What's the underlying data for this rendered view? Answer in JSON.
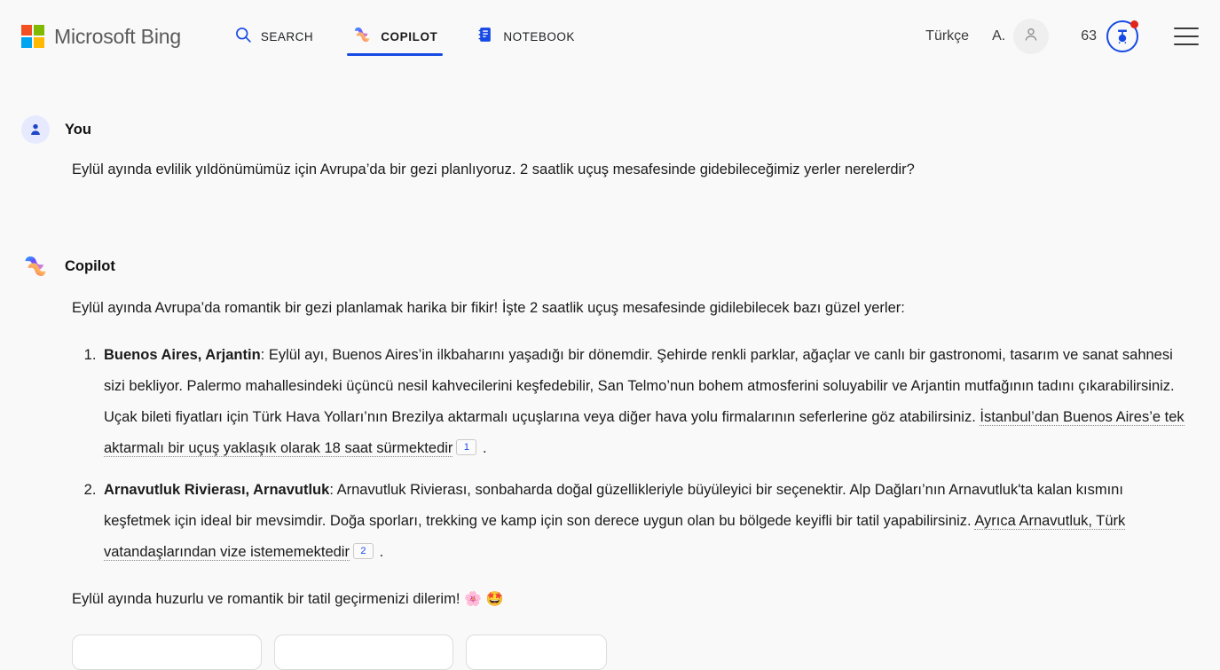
{
  "header": {
    "brand": "Microsoft Bing",
    "brand_logo_icon": "microsoft-logo-icon",
    "nav": [
      {
        "label": "SEARCH",
        "icon": "search-icon",
        "active": false
      },
      {
        "label": "COPILOT",
        "icon": "copilot-icon",
        "active": true
      },
      {
        "label": "NOTEBOOK",
        "icon": "notebook-icon",
        "active": false
      }
    ],
    "language": "Türkçe",
    "account_initial": "A.",
    "account_icon": "person-icon",
    "rewards_count": "63",
    "rewards_icon": "rewards-medal-icon",
    "rewards_has_notification": true,
    "menu_icon": "hamburger-menu-icon",
    "accent_color": "#174ae4",
    "notification_color": "#e2251b"
  },
  "conversation": {
    "user": {
      "author": "You",
      "avatar_icon": "user-avatar-icon",
      "text": "Eylül ayında evlilik yıldönümümüz için Avrupa’da bir gezi planlıyoruz. 2 saatlik uçuş mesafesinde gidebileceğimiz yerler nerelerdir?"
    },
    "assistant": {
      "author": "Copilot",
      "avatar_icon": "copilot-avatar-icon",
      "intro": "Eylül ayında Avrupa’da romantik bir gezi planlamak harika bir fikir! İşte 2 saatlik uçuş mesafesinde gidilebilecek bazı güzel yerler:",
      "items": [
        {
          "lead": "Buenos Aires, Arjantin",
          "separator": ": ",
          "body_before_link": "Eylül ayı, Buenos Aires’in ilkbaharını yaşadığı bir dönemdir. Şehirde renkli parklar, ağaçlar ve canlı bir gastronomi, tasarım ve sanat sahnesi sizi bekliyor. Palermo mahallesindeki üçüncü nesil kahvecilerini keşfedebilir, San Telmo’nun bohem atmosferini soluyabilir ve Arjantin mutfağının tadını çıkarabilirsiniz. Uçak bileti fiyatları için Türk Hava Yolları’nın Brezilya aktarmalı uçuşlarına veya diğer hava yolu firmalarının seferlerine göz atabilirsiniz. ",
          "link_text": "İstanbul’dan Buenos Aires’e tek aktarmalı bir uçuş yaklaşık olarak 18 saat sürmektedir",
          "citation": "1",
          "body_after_link": " ."
        },
        {
          "lead": "Arnavutluk Rivierası, Arnavutluk",
          "separator": ": ",
          "body_before_link": "Arnavutluk Rivierası, sonbaharda doğal güzellikleriyle büyüleyici bir seçenektir. Alp Dağları’nın Arnavutluk'ta kalan kısmını keşfetmek için ideal bir mevsimdir. Doğa sporları, trekking ve kamp için son derece uygun olan bu bölgede keyifli bir tatil yapabilirsiniz. ",
          "link_text": "Ayrıca Arnavutluk, Türk vatandaşlarından vize istememektedir",
          "citation": "2",
          "body_after_link": " ."
        }
      ],
      "closing": "Eylül ayında huzurlu ve romantik bir tatil geçirmenizi dilerim! ",
      "closing_emoji_1": "🌸",
      "closing_emoji_2": "🤩"
    }
  }
}
